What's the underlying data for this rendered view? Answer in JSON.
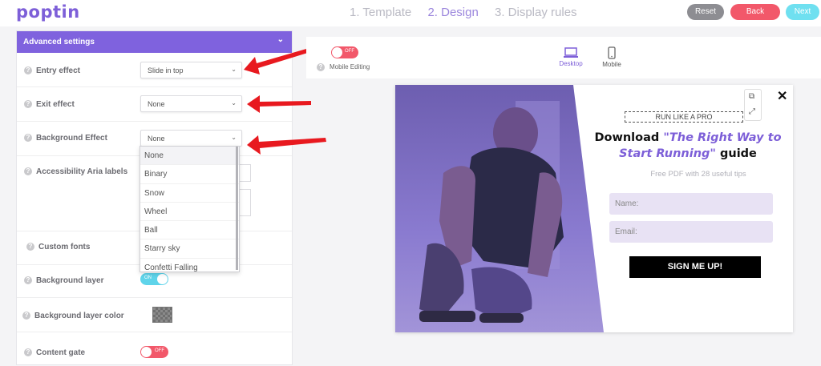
{
  "app": {
    "logo": "poptin"
  },
  "steps": [
    "1. Template",
    "2. Design",
    "3. Display rules"
  ],
  "buttons": {
    "reset": "Reset",
    "back": "Back",
    "next": "Next"
  },
  "panel": {
    "title": "Advanced settings",
    "entry_effect": {
      "label": "Entry effect",
      "value": "Slide in top"
    },
    "exit_effect": {
      "label": "Exit effect",
      "value": "None"
    },
    "background_effect": {
      "label": "Background Effect",
      "value": "None",
      "options": [
        "None",
        "Binary",
        "Snow",
        "Wheel",
        "Ball",
        "Starry sky",
        "Confetti Falling"
      ]
    },
    "accessibility": {
      "label": "Accessibility Aria labels"
    },
    "custom_fonts": {
      "label": "Custom fonts"
    },
    "background_layer": {
      "label": "Background layer",
      "toggle": "ON"
    },
    "background_layer_color": {
      "label": "Background layer color"
    },
    "content_gate": {
      "label": "Content gate",
      "toggle": "OFF"
    }
  },
  "preview": {
    "mobile_toggle": "OFF",
    "mobile_editing": "Mobile Editing",
    "desktop": "Desktop",
    "mobile": "Mobile"
  },
  "popup": {
    "eyebrow": "RUN LIKE A PRO",
    "headline_pre": "Download ",
    "headline_accent": "\"The Right Way to Start Running\"",
    "headline_post": " guide",
    "subtitle": "Free PDF with 28 useful tips",
    "name_placeholder": "Name:",
    "email_placeholder": "Email:",
    "cta": "SIGN ME UP!",
    "close": "✕"
  },
  "colors": {
    "accent": "#7f62de",
    "back": "#f2586a",
    "next": "#6fe0f0",
    "toggle_on": "#5fd4ea",
    "toggle_off": "#f2586a"
  }
}
